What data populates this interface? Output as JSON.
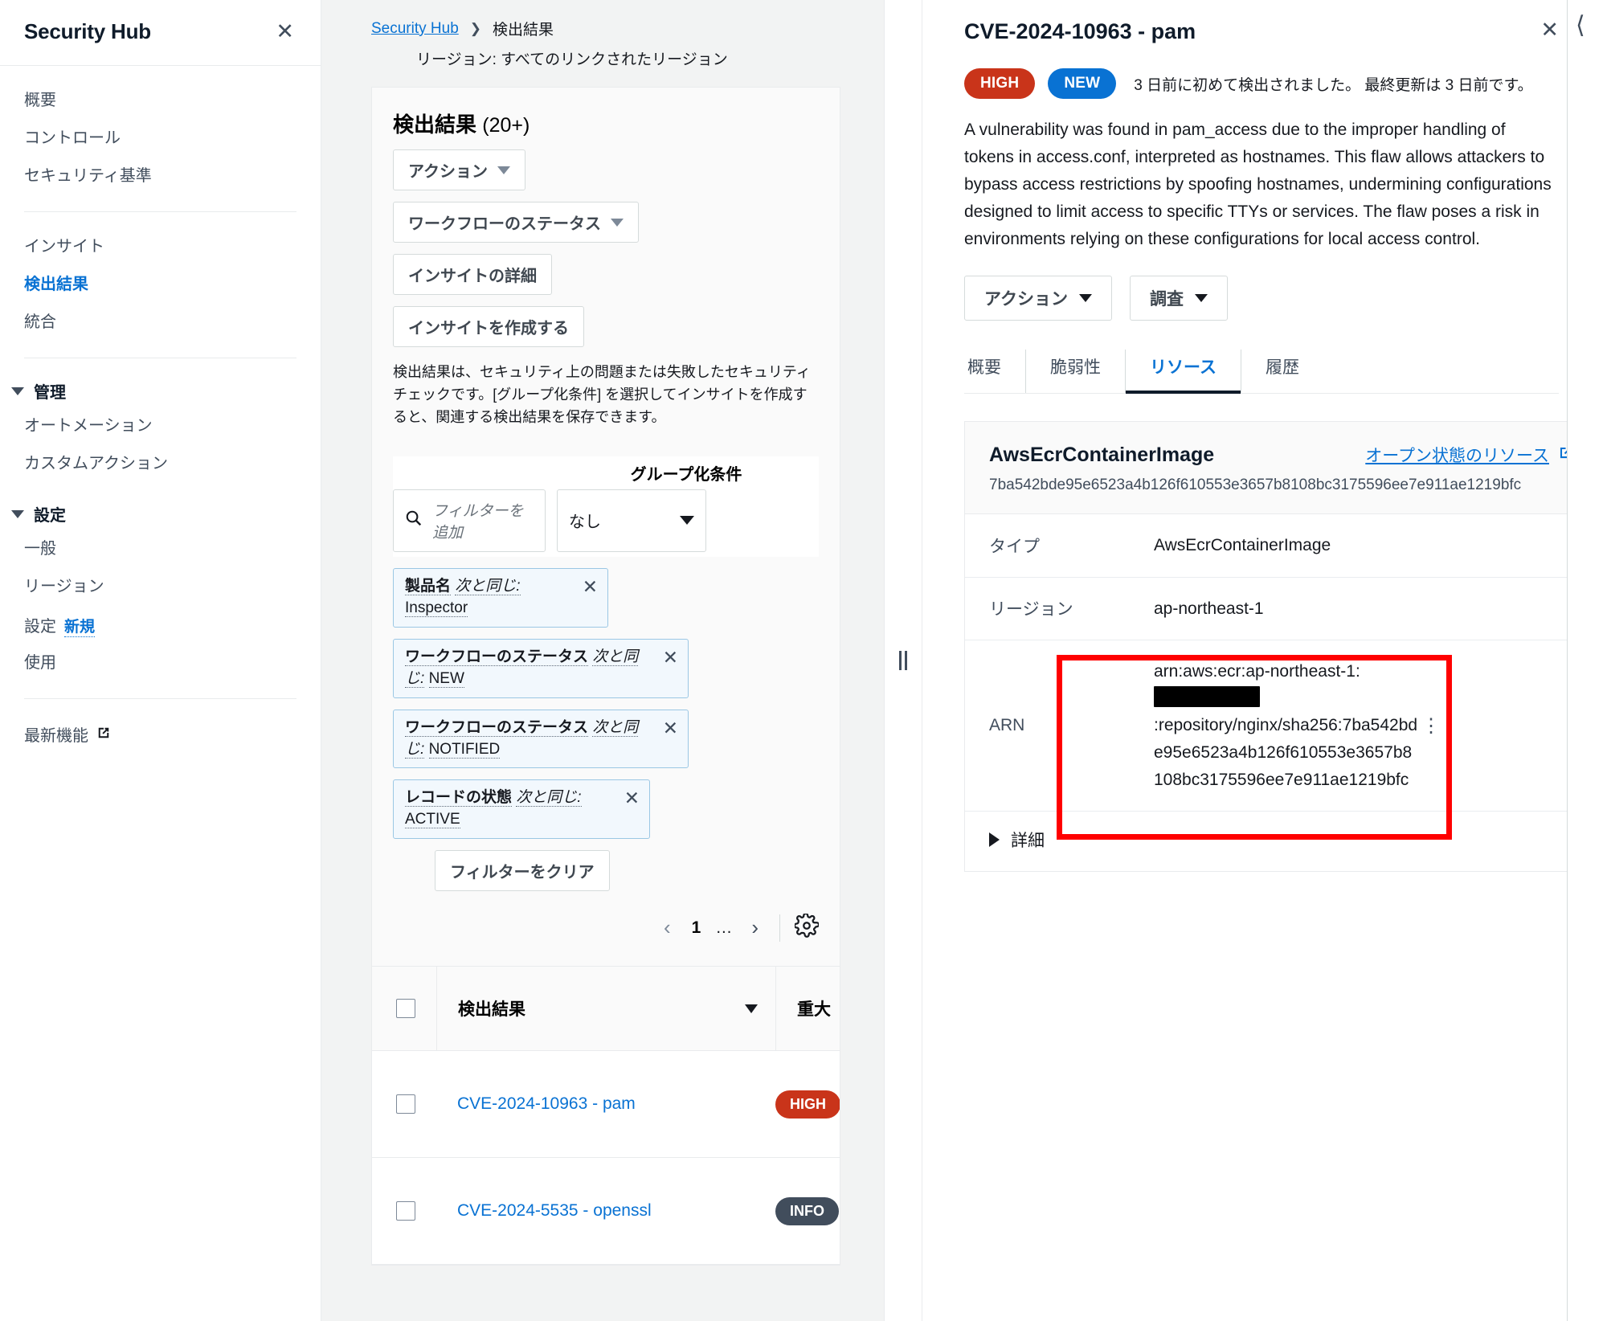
{
  "sidebar": {
    "title": "Security Hub",
    "close_icon": "close-icon",
    "items": [
      {
        "label": "概要",
        "active": false
      },
      {
        "label": "コントロール",
        "active": false
      },
      {
        "label": "セキュリティ基準",
        "active": false
      }
    ],
    "items2": [
      {
        "label": "インサイト",
        "active": false
      },
      {
        "label": "検出結果",
        "active": true
      },
      {
        "label": "統合",
        "active": false
      }
    ],
    "group_manage": {
      "label": "管理",
      "items": [
        {
          "label": "オートメーション"
        },
        {
          "label": "カスタムアクション"
        }
      ]
    },
    "group_settings": {
      "label": "設定",
      "items": [
        {
          "label": "一般",
          "badge": ""
        },
        {
          "label": "リージョン",
          "badge": ""
        },
        {
          "label": "設定",
          "badge": "新規"
        },
        {
          "label": "使用",
          "badge": ""
        }
      ]
    },
    "whats_new": {
      "label": "最新機能",
      "icon": "external-link-icon"
    }
  },
  "breadcrumb": {
    "root": "Security Hub",
    "separator": "❯",
    "current": "検出結果"
  },
  "region_line": "リージョン: すべてのリンクされたリージョン",
  "findings_panel": {
    "title": "検出結果",
    "count": "(20+)",
    "buttons": [
      {
        "label": "アクション",
        "caret": true
      },
      {
        "label": "ワークフローのステータス",
        "caret": true
      },
      {
        "label": "インサイトの詳細",
        "caret": false
      },
      {
        "label": "インサイトを作成する",
        "caret": false
      }
    ],
    "description": "検出結果は、セキュリティ上の問題または失敗したセキュリティチェックです。[グループ化条件] を選択してインサイトを作成すると、関連する検出結果を保存できます。",
    "group_by_label": "グループ化条件",
    "search_placeholder": "フィルターを追加",
    "search_icon": "search-icon",
    "group_by_value": "なし",
    "tokens": [
      {
        "key": "製品名",
        "op": "次と同じ:",
        "value": "Inspector",
        "width": "w1"
      },
      {
        "key": "ワークフローのステータス",
        "op": "次と同じ:",
        "value": "NEW",
        "width": "w2"
      },
      {
        "key": "ワークフローのステータス",
        "op": "次と同じ:",
        "value": "NOTIFIED",
        "width": "w2"
      },
      {
        "key": "レコードの状態",
        "op": "次と同じ:",
        "value": "ACTIVE",
        "width": "w3"
      }
    ],
    "clear_filters": "フィルターをクリア",
    "pagination": {
      "prev": "‹",
      "page": "1",
      "dots": "…",
      "next": "›",
      "settings_icon": "gear-icon"
    },
    "table": {
      "columns": [
        "検出結果",
        "重大"
      ],
      "rows": [
        {
          "name": "CVE-2024-10963 - pam",
          "severity": "HIGH",
          "severity_class": "sev-high"
        },
        {
          "name": "CVE-2024-5535 - openssl",
          "severity": "INFO",
          "severity_class": "sev-info"
        }
      ]
    }
  },
  "splitter": {
    "icon": "drag-handle-icon"
  },
  "detail": {
    "title": "CVE-2024-10963 - pam",
    "close_icon": "close-icon",
    "severity_badge": "HIGH",
    "status_badge": "NEW",
    "time_note": "3 日前に初めて検出されました。 最終更新は 3 日前です。",
    "description": "A vulnerability was found in pam_access due to the improper handling of tokens in access.conf, interpreted as hostnames. This flaw allows attackers to bypass access restrictions by spoofing hostnames, undermining configurations designed to limit access to specific TTYs or services. The flaw poses a risk in environments relying on these configurations for local access control.",
    "buttons": [
      {
        "label": "アクション",
        "caret": true
      },
      {
        "label": "調査",
        "caret": true
      }
    ],
    "tabs": [
      {
        "label": "概要",
        "selected": false
      },
      {
        "label": "脆弱性",
        "selected": false
      },
      {
        "label": "リソース",
        "selected": true
      },
      {
        "label": "履歴",
        "selected": false
      }
    ],
    "resource": {
      "name": "AwsEcrContainerImage",
      "open_link": "オープン状態のリソース",
      "open_link_icon": "external-link-icon",
      "digest": "7ba542bde95e6523a4b126f610553e3657b8108bc3175596ee7e911ae1219bfc",
      "rows": [
        {
          "key": "タイプ",
          "value": "AwsEcrContainerImage",
          "menu_icon": "kebab-menu-icon"
        },
        {
          "key": "リージョン",
          "value": "ap-northeast-1",
          "menu_icon": "kebab-menu-icon"
        }
      ],
      "arn_key": "ARN",
      "arn_prefix": "arn:aws:ecr:ap-northeast-1:",
      "arn_redacted": "redacted-account-id",
      "arn_suffix": ":repository/nginx/sha256:7ba542bde95e6523a4b126f610553e3657b8108bc3175596ee7e911ae1219bfc",
      "arn_menu_icon": "kebab-menu-icon",
      "details_expander": "詳細",
      "highlight_color": "#ff0000"
    }
  },
  "colors": {
    "accent_blue": "#0972d3",
    "severity_high": "#c9341a",
    "severity_info": "#414d5c",
    "highlight_red": "#ff0000",
    "panel_bg": "#f2f3f3"
  }
}
